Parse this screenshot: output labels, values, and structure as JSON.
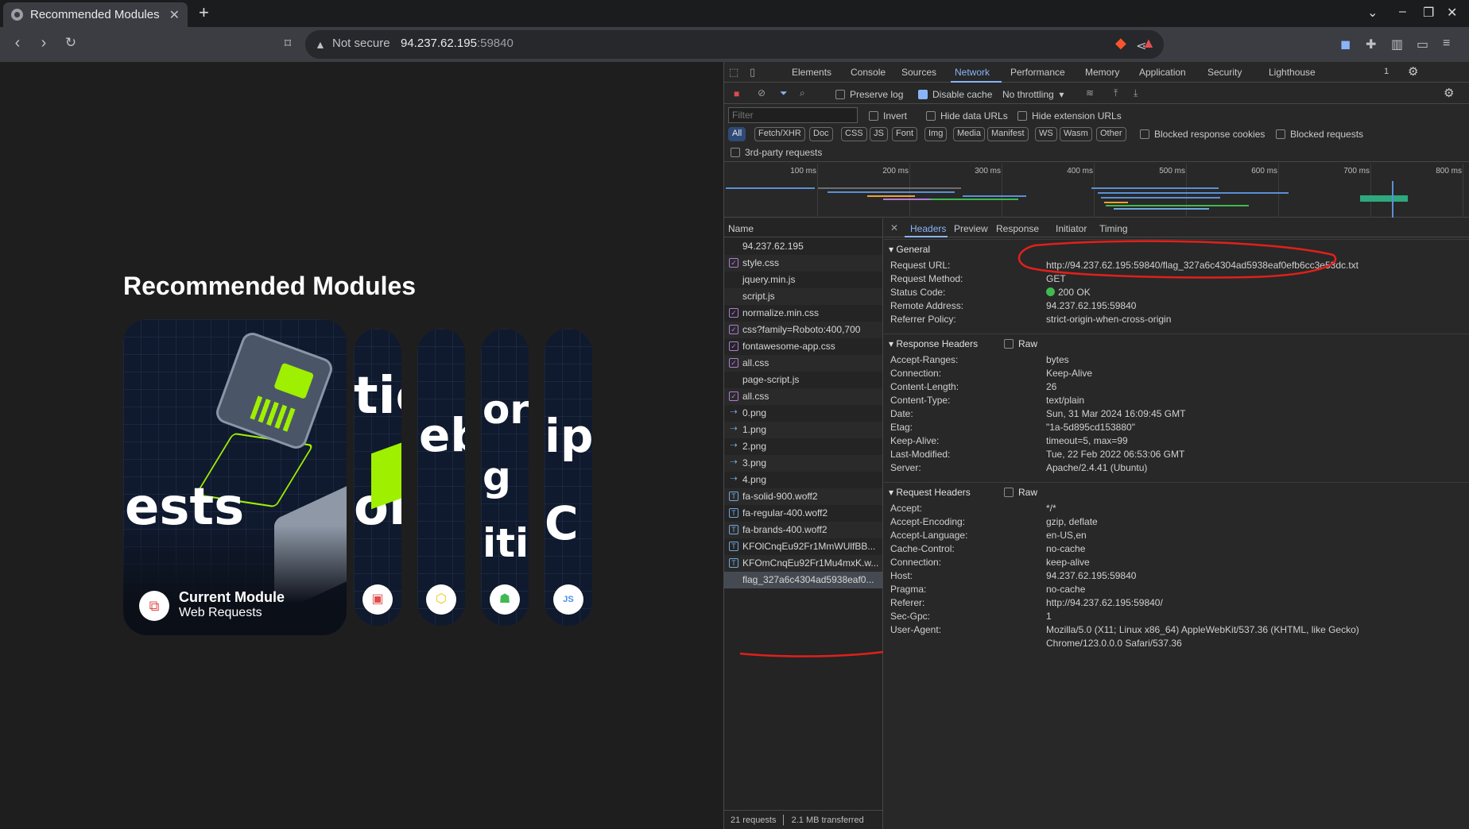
{
  "tab": {
    "title": "Recommended Modules",
    "close": "✕"
  },
  "omnibox": {
    "security": "Not secure",
    "host": "94.237.62.195",
    "port": ":59840"
  },
  "page": {
    "heading": "Recommended Modules",
    "current_module": {
      "title": "Current Module",
      "subtitle": "Web Requests",
      "art_text": "ests"
    },
    "slim_cards": [
      {
        "art": "tic\n\nor"
      },
      {
        "art": "eb"
      },
      {
        "art": "or\ng\niti"
      },
      {
        "art": "ip\nC"
      }
    ]
  },
  "devtools": {
    "tabs": [
      "Elements",
      "Console",
      "Sources",
      "Network",
      "Performance",
      "Memory",
      "Application",
      "Security",
      "Lighthouse"
    ],
    "active_tab": "Network",
    "issues_count": "1",
    "toolbar": {
      "preserve_log": "Preserve log",
      "disable_cache": "Disable cache",
      "throttling": "No throttling"
    },
    "filter_placeholder": "Filter",
    "filter_options": {
      "invert": "Invert",
      "hide_data_urls": "Hide data URLs",
      "hide_ext_urls": "Hide extension URLs"
    },
    "type_filters": [
      "All",
      "Fetch/XHR",
      "Doc",
      "CSS",
      "JS",
      "Font",
      "Img",
      "Media",
      "Manifest",
      "WS",
      "Wasm",
      "Other"
    ],
    "blocked_cookies": "Blocked response cookies",
    "blocked_requests": "Blocked requests",
    "third_party": "3rd-party requests",
    "timeline_ticks": [
      "100 ms",
      "200 ms",
      "300 ms",
      "400 ms",
      "500 ms",
      "600 ms",
      "700 ms",
      "800 ms"
    ],
    "name_header": "Name",
    "requests": [
      {
        "name": "94.237.62.195",
        "icon": ""
      },
      {
        "name": "style.css",
        "icon": "css"
      },
      {
        "name": "jquery.min.js",
        "icon": ""
      },
      {
        "name": "script.js",
        "icon": ""
      },
      {
        "name": "normalize.min.css",
        "icon": "css"
      },
      {
        "name": "css?family=Roboto:400,700",
        "icon": "css"
      },
      {
        "name": "fontawesome-app.css",
        "icon": "css"
      },
      {
        "name": "all.css",
        "icon": "css"
      },
      {
        "name": "page-script.js",
        "icon": ""
      },
      {
        "name": "all.css",
        "icon": "css"
      },
      {
        "name": "0.png",
        "icon": "img"
      },
      {
        "name": "1.png",
        "icon": "img"
      },
      {
        "name": "2.png",
        "icon": "img"
      },
      {
        "name": "3.png",
        "icon": "img"
      },
      {
        "name": "4.png",
        "icon": "img"
      },
      {
        "name": "fa-solid-900.woff2",
        "icon": "font"
      },
      {
        "name": "fa-regular-400.woff2",
        "icon": "font"
      },
      {
        "name": "fa-brands-400.woff2",
        "icon": "font"
      },
      {
        "name": "KFOlCnqEu92Fr1MmWUlfBB...",
        "icon": "font"
      },
      {
        "name": "KFOmCnqEu92Fr1Mu4mxK.w...",
        "icon": "font"
      },
      {
        "name": "flag_327a6c4304ad5938eaf0...",
        "icon": ""
      }
    ],
    "footer": {
      "requests": "21 requests",
      "transferred": "2.1 MB transferred"
    },
    "detail_tabs": [
      "Headers",
      "Preview",
      "Response",
      "Initiator",
      "Timing"
    ],
    "general": {
      "title": "General",
      "rows": [
        {
          "k": "Request URL:",
          "v": "http://94.237.62.195:59840/flag_327a6c4304ad5938eaf0efb6cc3e53dc.txt"
        },
        {
          "k": "Request Method:",
          "v": "GET"
        },
        {
          "k": "Status Code:",
          "v": "200 OK"
        },
        {
          "k": "Remote Address:",
          "v": "94.237.62.195:59840"
        },
        {
          "k": "Referrer Policy:",
          "v": "strict-origin-when-cross-origin"
        }
      ]
    },
    "response_headers": {
      "title": "Response Headers",
      "raw": "Raw",
      "rows": [
        {
          "k": "Accept-Ranges:",
          "v": "bytes"
        },
        {
          "k": "Connection:",
          "v": "Keep-Alive"
        },
        {
          "k": "Content-Length:",
          "v": "26"
        },
        {
          "k": "Content-Type:",
          "v": "text/plain"
        },
        {
          "k": "Date:",
          "v": "Sun, 31 Mar 2024 16:09:45 GMT"
        },
        {
          "k": "Etag:",
          "v": "\"1a-5d895cd153880\""
        },
        {
          "k": "Keep-Alive:",
          "v": "timeout=5, max=99"
        },
        {
          "k": "Last-Modified:",
          "v": "Tue, 22 Feb 2022 06:53:06 GMT"
        },
        {
          "k": "Server:",
          "v": "Apache/2.4.41 (Ubuntu)"
        }
      ]
    },
    "request_headers": {
      "title": "Request Headers",
      "raw": "Raw",
      "rows": [
        {
          "k": "Accept:",
          "v": "*/*"
        },
        {
          "k": "Accept-Encoding:",
          "v": "gzip, deflate"
        },
        {
          "k": "Accept-Language:",
          "v": "en-US,en"
        },
        {
          "k": "Cache-Control:",
          "v": "no-cache"
        },
        {
          "k": "Connection:",
          "v": "keep-alive"
        },
        {
          "k": "Host:",
          "v": "94.237.62.195:59840"
        },
        {
          "k": "Pragma:",
          "v": "no-cache"
        },
        {
          "k": "Referer:",
          "v": "http://94.237.62.195:59840/"
        },
        {
          "k": "Sec-Gpc:",
          "v": "1"
        },
        {
          "k": "User-Agent:",
          "v": "Mozilla/5.0 (X11; Linux x86_64) AppleWebKit/537.36 (KHTML, like Gecko)"
        },
        {
          "k": "",
          "v": "Chrome/123.0.0.0 Safari/537.36"
        }
      ]
    }
  },
  "colors": {
    "accent": "#8ab4f8",
    "brand_green": "#9fef00",
    "annotation_red": "#e0201b",
    "status_ok": "#3fb950"
  }
}
